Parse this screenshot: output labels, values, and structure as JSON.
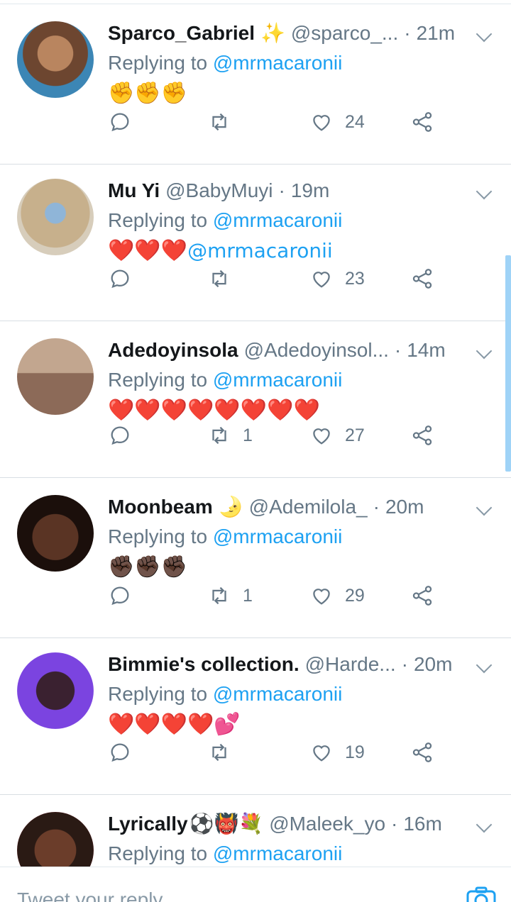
{
  "tweets": [
    {
      "name": "Sparco_Gabriel",
      "name_emoji": "✨",
      "handle": "@sparco_...",
      "time": "21m",
      "reply_prefix": "Replying to",
      "reply_to": "@mrmacaronii",
      "body": "✊✊✊",
      "body_mention": "",
      "retweets": "",
      "likes": "24",
      "avatar_bg": "#8a5a3c"
    },
    {
      "name": "Mu Yi",
      "name_emoji": "",
      "handle": "@BabyMuyi",
      "time": "19m",
      "reply_prefix": "Replying to",
      "reply_to": "@mrmacaronii",
      "body": "❤️❤️❤️",
      "body_mention": "@mrmacaronii",
      "retweets": "",
      "likes": "23",
      "avatar_bg": "#c9b79a"
    },
    {
      "name": "Adedoyinsola",
      "name_emoji": "",
      "handle": "@Adedoyinsol...",
      "time": "14m",
      "reply_prefix": "Replying to",
      "reply_to": "@mrmacaronii",
      "body": "❤️❤️❤️❤️❤️❤️❤️❤️",
      "body_mention": "",
      "retweets": "1",
      "likes": "27",
      "avatar_bg": "#a58a76"
    },
    {
      "name": "Moonbeam",
      "name_emoji": "🌛",
      "handle": "@Ademilola_",
      "time": "20m",
      "reply_prefix": "Replying to",
      "reply_to": "@mrmacaronii",
      "body": "✊🏿✊🏿✊🏿",
      "body_mention": "",
      "retweets": "1",
      "likes": "29",
      "avatar_bg": "#3b2418"
    },
    {
      "name": "Bimmie's collection.",
      "name_emoji": "",
      "handle": "@Harde...",
      "time": "20m",
      "reply_prefix": "Replying to",
      "reply_to": "@mrmacaronii",
      "body": "❤️❤️❤️❤️💕",
      "body_mention": "",
      "retweets": "",
      "likes": "19",
      "avatar_bg": "#7a3fd6"
    },
    {
      "name": "Lyrically",
      "name_emoji": "⚽👹💐",
      "handle": "@Maleek_yo",
      "time": "16m",
      "reply_prefix": "Replying to",
      "reply_to": "@mrmacaronii",
      "body": "",
      "body_mention": "",
      "retweets": "",
      "likes": "",
      "avatar_bg": "#4a2a1e"
    }
  ],
  "compose": {
    "placeholder": "Tweet your reply"
  },
  "colors": {
    "link": "#1da1f2",
    "muted": "#657786",
    "icon": "#657786"
  }
}
